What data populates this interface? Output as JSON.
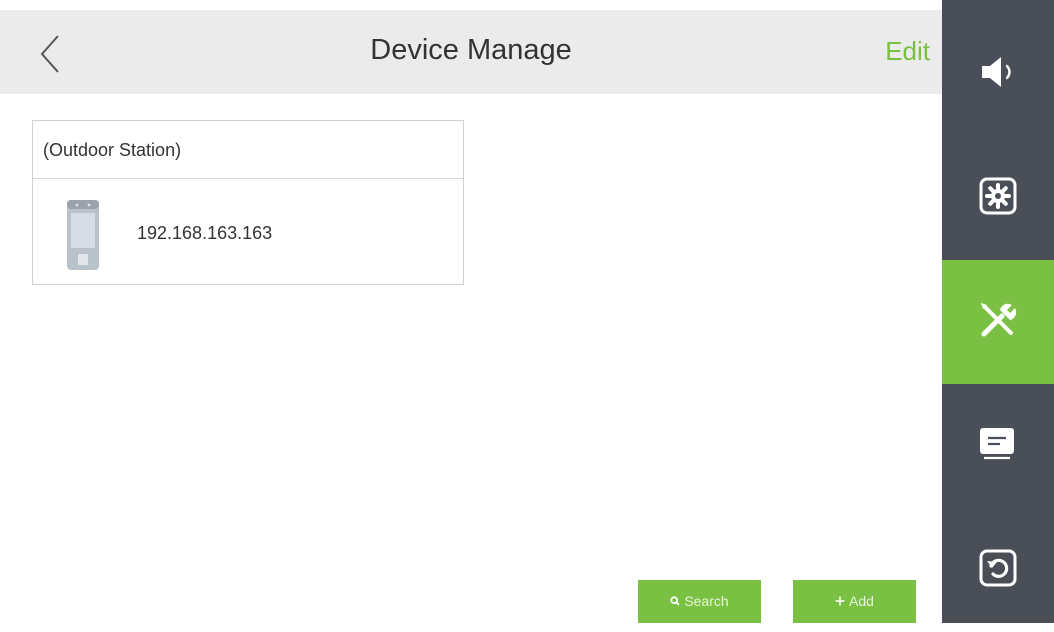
{
  "header": {
    "title": "Device Manage",
    "edit_label": "Edit"
  },
  "colors": {
    "accent": "#7ac143",
    "sidebar_bg": "#4a4f57",
    "header_bg": "#ebebeb",
    "text": "#333333",
    "icon_inactive": "#ffffff"
  },
  "card": {
    "group_label": "(Outdoor Station)",
    "device": {
      "ip": "192.168.163.163",
      "icon": "outdoor-station-icon"
    }
  },
  "buttons": {
    "search_label": "Search",
    "search_icon": "search-icon",
    "add_label": "Add",
    "add_icon": "plus-icon"
  },
  "sidebar": {
    "items": [
      {
        "icon": "speaker-icon",
        "active": false
      },
      {
        "icon": "settings-gear-icon",
        "active": false
      },
      {
        "icon": "tools-icon",
        "active": true
      },
      {
        "icon": "message-icon",
        "active": false
      },
      {
        "icon": "restore-icon",
        "active": false
      }
    ]
  }
}
